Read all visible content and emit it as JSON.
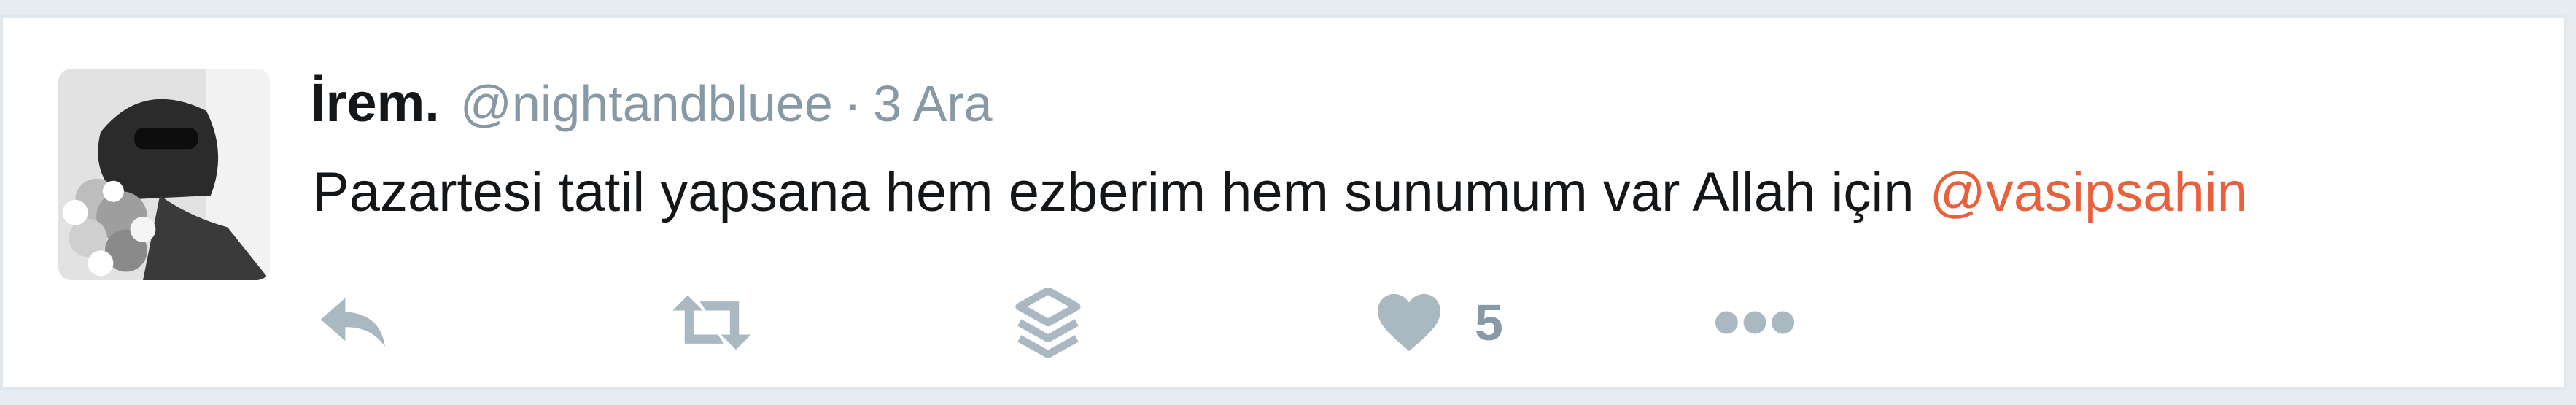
{
  "tweet": {
    "author_name": "İrem.",
    "handle": "@nightandbluee",
    "separator": "·",
    "timestamp": "3 Ara",
    "text": "Pazartesi tatil yapsana hem ezberim hem sunumum var Allah için",
    "mention": "@vasipsahin"
  },
  "actions": {
    "reply_icon": "reply-icon",
    "retweet_icon": "retweet-icon",
    "layers_icon": "layers-icon",
    "like_icon": "heart-icon",
    "like_count": "5",
    "more_icon": "more-icon"
  },
  "colors": {
    "mention": "#e8603c",
    "icon": "#aab8c2",
    "muted_text": "#8899a6",
    "border": "#e1e8ed"
  }
}
